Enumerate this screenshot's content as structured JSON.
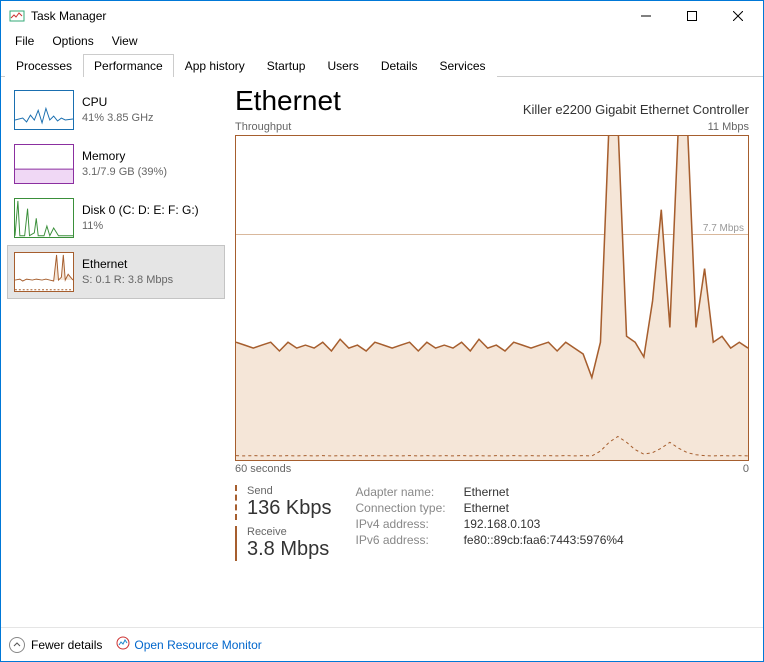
{
  "window": {
    "title": "Task Manager"
  },
  "menu": {
    "file": "File",
    "options": "Options",
    "view": "View"
  },
  "tabs": {
    "processes": "Processes",
    "performance": "Performance",
    "apphistory": "App history",
    "startup": "Startup",
    "users": "Users",
    "details": "Details",
    "services": "Services"
  },
  "cards": {
    "cpu": {
      "title": "CPU",
      "sub": "41%  3.85 GHz"
    },
    "mem": {
      "title": "Memory",
      "sub": "3.1/7.9 GB (39%)"
    },
    "disk": {
      "title": "Disk 0 (C: D: E: F: G:)",
      "sub": "11%"
    },
    "eth": {
      "title": "Ethernet",
      "sub": "S: 0.1 R: 3.8 Mbps"
    }
  },
  "main": {
    "heading": "Ethernet",
    "adapter": "Killer e2200 Gigabit Ethernet Controller",
    "chart_top_left": "Throughput",
    "chart_top_right": "11 Mbps",
    "chart_mid_label": "7.7 Mbps",
    "axis_left": "60 seconds",
    "axis_right": "0"
  },
  "stats": {
    "send_label": "Send",
    "send_value": "136 Kbps",
    "recv_label": "Receive",
    "recv_value": "3.8 Mbps"
  },
  "props": {
    "k1": "Adapter name:",
    "v1": "Ethernet",
    "k2": "Connection type:",
    "v2": "Ethernet",
    "k3": "IPv4 address:",
    "v3": "192.168.0.103",
    "k4": "IPv6 address:",
    "v4": "fe80::89cb:faa6:7443:5976%4"
  },
  "footer": {
    "fewer": "Fewer details",
    "monitor": "Open Resource Monitor"
  },
  "chart_data": {
    "type": "line",
    "ylim": [
      0,
      11
    ],
    "xlabel": "60 seconds",
    "ylabel": "Throughput",
    "gridline_at": 7.7,
    "series": [
      {
        "name": "Receive",
        "values": [
          4.0,
          3.9,
          3.8,
          3.9,
          4.0,
          3.7,
          4.0,
          3.8,
          3.9,
          3.8,
          4.0,
          3.7,
          4.1,
          3.8,
          3.9,
          3.7,
          4.0,
          3.9,
          3.8,
          3.9,
          4.0,
          3.7,
          4.0,
          3.8,
          3.9,
          3.8,
          4.0,
          3.7,
          4.1,
          3.8,
          3.9,
          3.7,
          4.0,
          3.9,
          3.8,
          3.9,
          4.0,
          3.7,
          4.0,
          3.8,
          3.6,
          2.8,
          4.0,
          11.5,
          11.5,
          4.2,
          4.0,
          3.5,
          5.4,
          8.5,
          4.5,
          11.5,
          11.5,
          4.5,
          6.5,
          4.0,
          4.2,
          3.8,
          4.0,
          3.8
        ]
      },
      {
        "name": "Send",
        "values": [
          0.15,
          0.14,
          0.15,
          0.14,
          0.15,
          0.14,
          0.15,
          0.14,
          0.15,
          0.14,
          0.15,
          0.14,
          0.15,
          0.14,
          0.15,
          0.14,
          0.15,
          0.14,
          0.15,
          0.14,
          0.15,
          0.14,
          0.15,
          0.14,
          0.15,
          0.14,
          0.15,
          0.14,
          0.15,
          0.14,
          0.15,
          0.14,
          0.15,
          0.14,
          0.15,
          0.14,
          0.15,
          0.14,
          0.15,
          0.14,
          0.15,
          0.14,
          0.3,
          0.6,
          0.8,
          0.6,
          0.35,
          0.2,
          0.25,
          0.4,
          0.6,
          0.4,
          0.25,
          0.18,
          0.15,
          0.14,
          0.15,
          0.14,
          0.15,
          0.14
        ]
      }
    ]
  }
}
